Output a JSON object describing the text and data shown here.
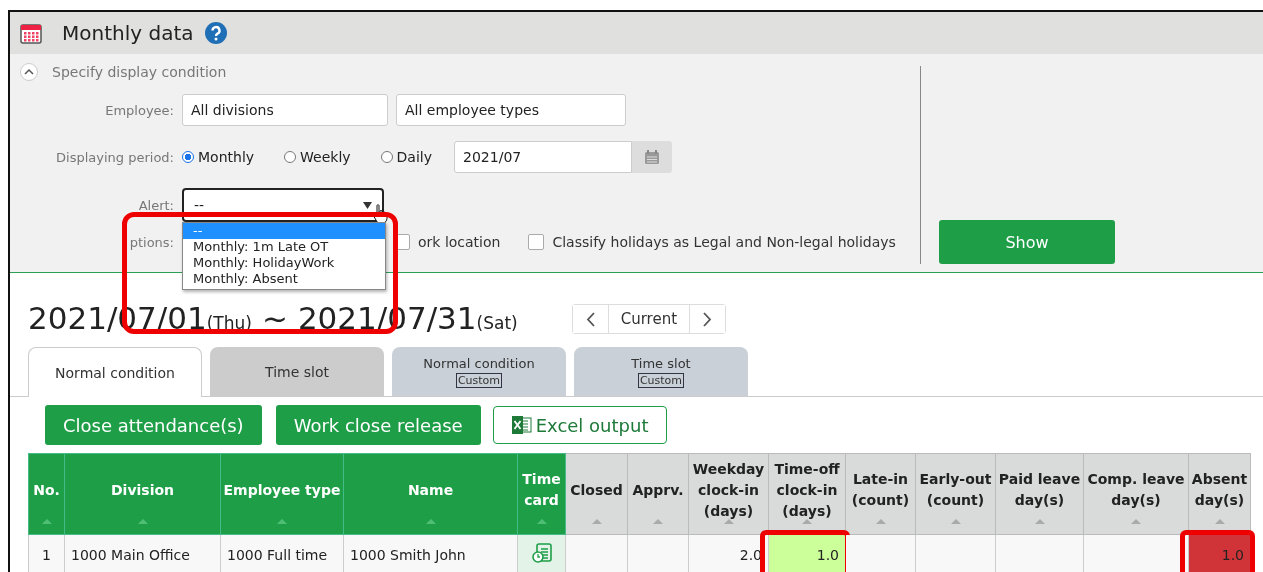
{
  "title": "Monthly data",
  "conditions": {
    "header": "Specify display condition",
    "expanded": true,
    "employee_label": "Employee:",
    "division": "All divisions",
    "employee_type": "All employee types",
    "period_label": "Displaying period:",
    "periods": [
      {
        "label": "Monthly",
        "selected": true
      },
      {
        "label": "Weekly",
        "selected": false
      },
      {
        "label": "Daily",
        "selected": false
      }
    ],
    "month": "2021/07",
    "alert_label": "Alert:",
    "alert_value": "--",
    "alert_annotated": true,
    "alert_options": [
      {
        "label": "--",
        "selected": true
      },
      {
        "label": "Monthly: 1m Late OT",
        "selected": false
      },
      {
        "label": "Monthly: HolidayWork",
        "selected": false
      },
      {
        "label": "Monthly: Absent",
        "selected": false
      }
    ],
    "options_label": "ptions:",
    "options": [
      {
        "label": "ork location",
        "checked": false
      },
      {
        "label": "Classify holidays as Legal and Non-legal holidays",
        "checked": false
      }
    ],
    "show_button": "Show"
  },
  "range": {
    "start": "2021/07/01",
    "start_day": "(Thu)",
    "separator": "~",
    "end": "2021/07/31",
    "end_day": "(Sat)"
  },
  "nav": {
    "current": "Current"
  },
  "tabs": [
    {
      "label": "Normal condition",
      "selected": true
    },
    {
      "label": "Time slot",
      "selected": false
    },
    {
      "label": "Normal condition",
      "badge": "Custom",
      "selected": false
    },
    {
      "label": "Time slot",
      "badge": "Custom",
      "selected": false
    }
  ],
  "actions": [
    "Close attendance(s)",
    "Work close release"
  ],
  "excel_button": "Excel output",
  "table": {
    "columns": [
      {
        "label": "No.",
        "kind": "green"
      },
      {
        "label": "Division",
        "kind": "green"
      },
      {
        "label": "Employee type",
        "kind": "green"
      },
      {
        "label": "Name",
        "kind": "green"
      },
      {
        "label": "Time card",
        "kind": "green"
      },
      {
        "label": "Closed",
        "kind": "gray"
      },
      {
        "label": "Apprv.",
        "kind": "gray"
      },
      {
        "label": "Weekday clock-in (days)",
        "kind": "gray"
      },
      {
        "label": "Time-off clock-in (days)",
        "kind": "gray"
      },
      {
        "label": "Late-in (count)",
        "kind": "gray"
      },
      {
        "label": "Early-out (count)",
        "kind": "gray"
      },
      {
        "label": "Paid leave day(s)",
        "kind": "gray"
      },
      {
        "label": "Comp. leave day(s)",
        "kind": "gray"
      },
      {
        "label": "Absent day(s)",
        "kind": "gray"
      }
    ],
    "rows": [
      {
        "cells": [
          {
            "text": "1"
          },
          {
            "text": "1000 Main Office"
          },
          {
            "text": "1000 Full time"
          },
          {
            "text": "1000 Smith John"
          },
          {
            "kind": "timecard"
          },
          {},
          {},
          {
            "text": "2.0"
          },
          {
            "text": "1.0",
            "color": "#ccff99",
            "annotated": true
          },
          {},
          {},
          {},
          {},
          {
            "text": "1.0",
            "color": "#d13438",
            "annotated": true
          }
        ]
      }
    ]
  }
}
